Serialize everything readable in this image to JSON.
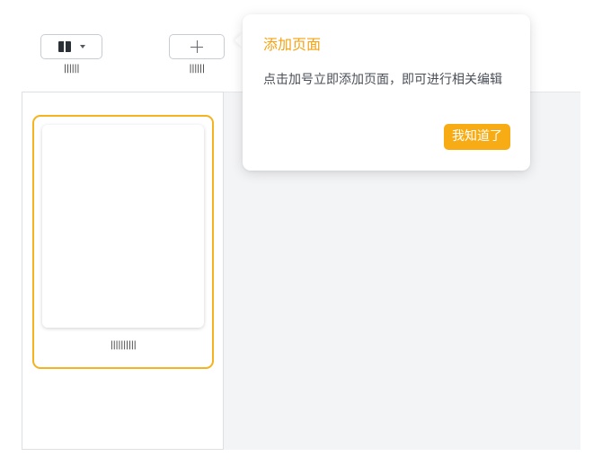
{
  "toolbar": {
    "layout_button_label": "||||||",
    "add_page_button_label": "||||||"
  },
  "page_list": {
    "pages": [
      {
        "name": "||||||||||"
      }
    ]
  },
  "popover": {
    "title": "添加页面",
    "body": "点击加号立即添加页面，即可进行相关编辑",
    "confirm_label": "我知道了"
  },
  "colors": {
    "accent": "#f4b31f",
    "button": "#f7ac16",
    "canvas_bg": "#f3f4f6"
  },
  "icons": {
    "layout": "layout-panel-icon",
    "dropdown": "caret-down-icon",
    "add": "plus-icon"
  }
}
